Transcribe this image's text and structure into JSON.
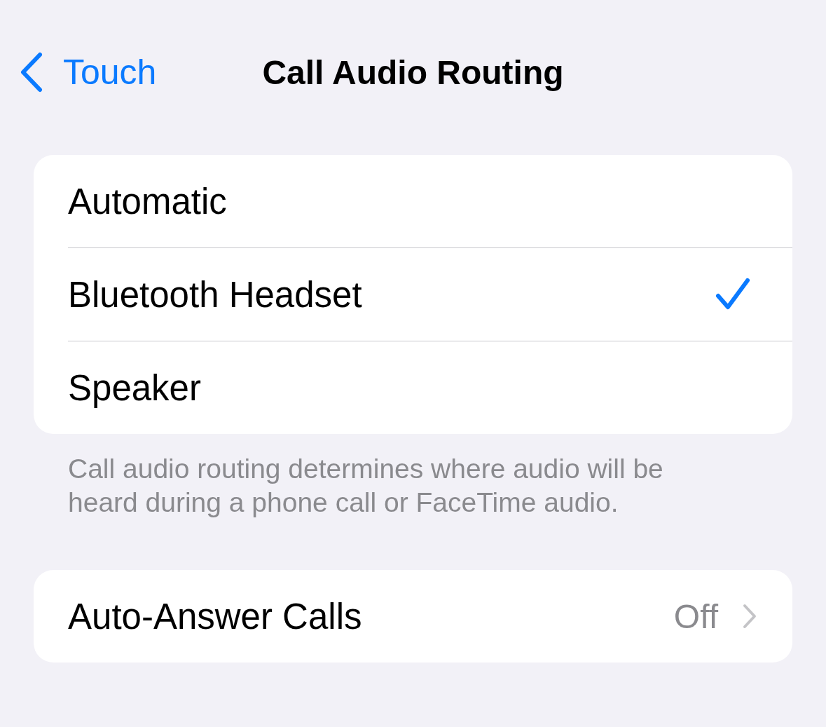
{
  "nav": {
    "back_label": "Touch",
    "title": "Call Audio Routing"
  },
  "routing_options": [
    {
      "label": "Automatic",
      "selected": false
    },
    {
      "label": "Bluetooth Headset",
      "selected": true
    },
    {
      "label": "Speaker",
      "selected": false
    }
  ],
  "routing_footer": "Call audio routing determines where audio will be heard during a phone call or FaceTime audio.",
  "auto_answer": {
    "label": "Auto-Answer Calls",
    "value": "Off"
  }
}
